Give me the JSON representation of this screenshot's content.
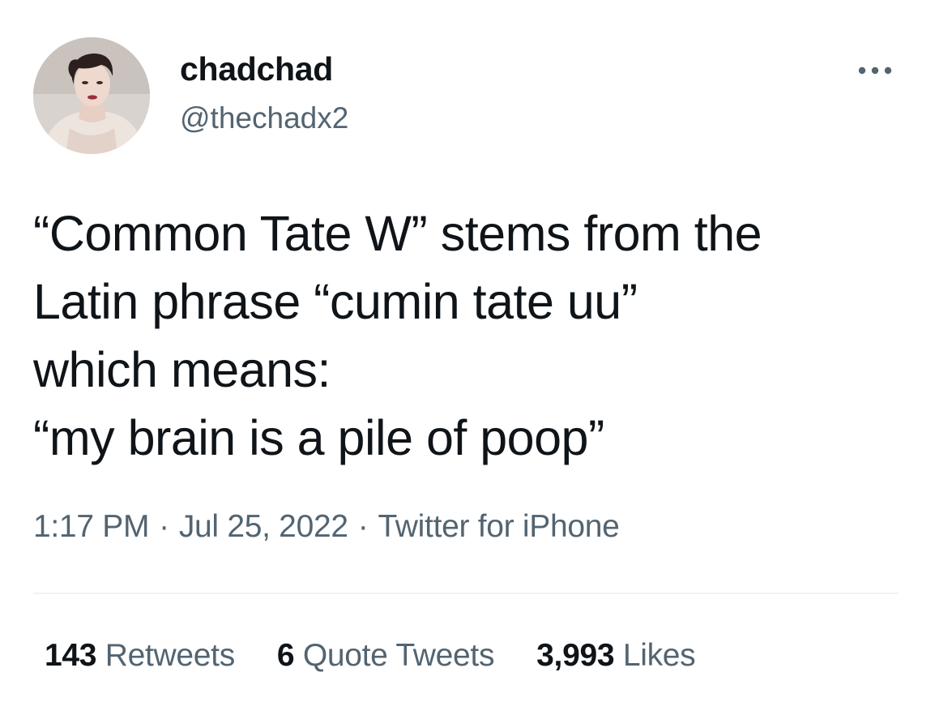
{
  "author": {
    "display_name": "chadchad",
    "handle": "@thechadx2",
    "avatar_icon": "profile-photo"
  },
  "more_icon": "more-horizontal-icon",
  "tweet": {
    "text": "“Common Tate W” stems from the\nLatin phrase “cumin tate uu”\nwhich means:\n“my brain is a pile of poop”"
  },
  "meta": {
    "time": "1:17 PM",
    "date": "Jul 25, 2022",
    "source": "Twitter for iPhone",
    "separator": "·"
  },
  "stats": {
    "retweets": {
      "count": "143",
      "label": "Retweets"
    },
    "quotes": {
      "count": "6",
      "label": "Quote Tweets"
    },
    "likes": {
      "count": "3,993",
      "label": "Likes"
    }
  },
  "colors": {
    "text_primary": "#0f1419",
    "text_secondary": "#536471",
    "divider": "#eff3f4",
    "background": "#ffffff"
  }
}
